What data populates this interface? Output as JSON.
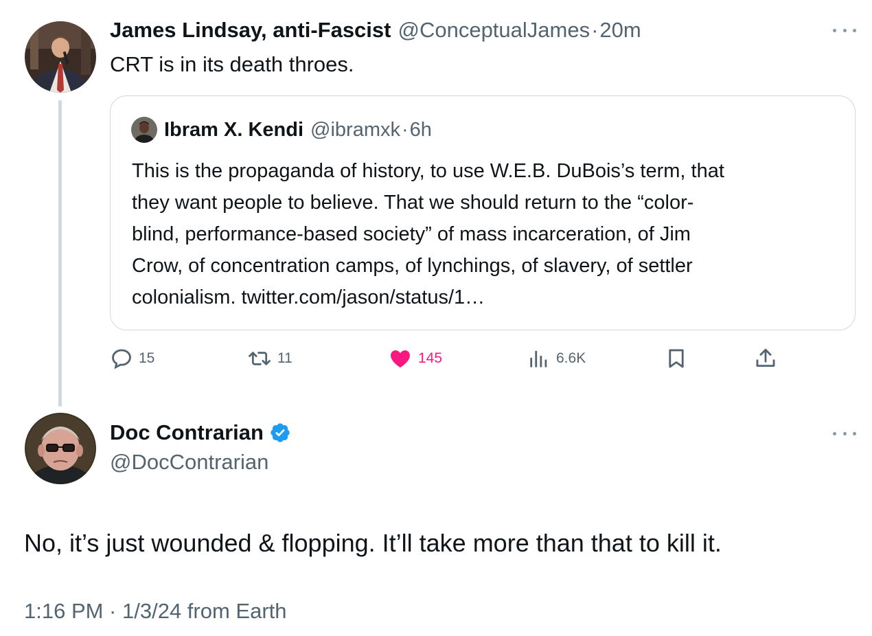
{
  "tweet1": {
    "author_name": "James Lindsay, anti-Fascist",
    "handle": "@ConceptualJames",
    "separator": "·",
    "time": "20m",
    "text": "CRT is in its death throes."
  },
  "quote": {
    "author_name": "Ibram X. Kendi",
    "handle": "@ibramxk",
    "separator": "·",
    "time": "6h",
    "lines": [
      "This is the propaganda of history, to use W.E.B. DuBois’s term, that",
      "they want people to believe. That we should return to the “color-",
      "blind, performance-based society” of mass incarceration, of Jim",
      "Crow, of concentration camps, of lynchings, of slavery, of settler",
      "colonialism. twitter.com/jason/status/1…"
    ]
  },
  "actions": {
    "replies": "15",
    "reposts": "11",
    "likes": "145",
    "views": "6.6K",
    "icons": [
      "reply-icon",
      "repost-icon",
      "like-icon",
      "views-icon",
      "bookmark-icon",
      "share-icon"
    ],
    "like_color": "#f91880",
    "icon_color": "#536471"
  },
  "tweet2": {
    "author_name": "Doc Contrarian",
    "handle": "@DocContrarian",
    "verified_color": "#1d9bf0",
    "text": "No, it’s just wounded & flopping. It’ll take more than that to kill it.",
    "meta": "1:16 PM · 1/3/24 from Earth"
  }
}
